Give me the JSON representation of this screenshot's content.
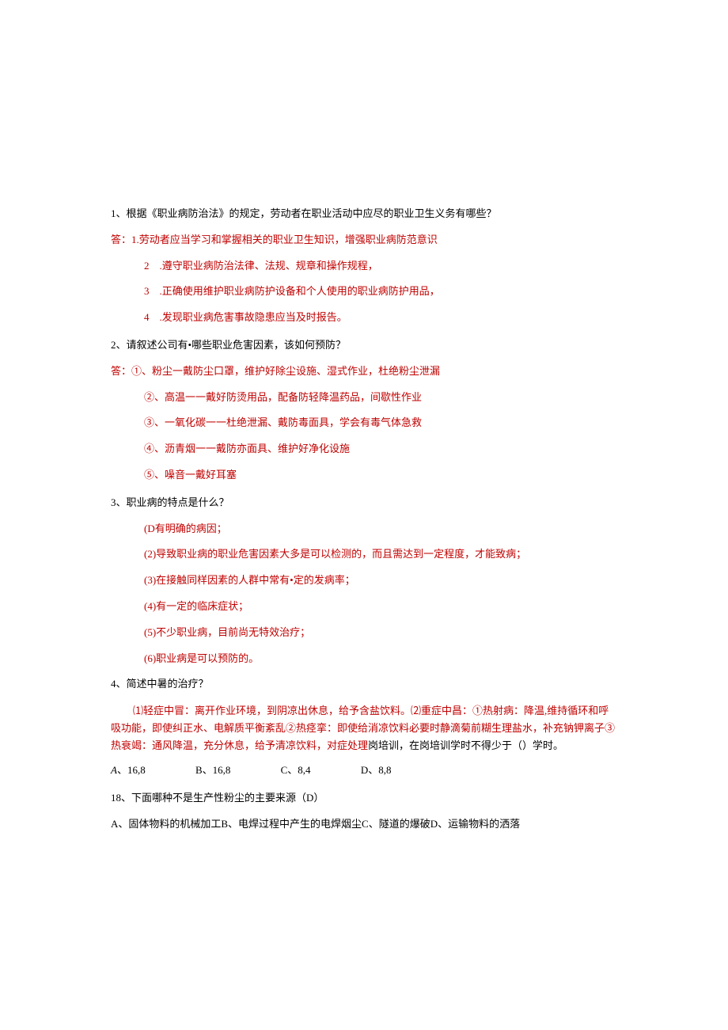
{
  "q1": {
    "text": "1、根据《职业病防治法》的规定，劳动者在职业活动中应尽的职业卫生义务有哪些？",
    "ans_prefix": "答：1.劳动者应当学习和掌握相关的职业卫生知识，增强职业病防范意识",
    "a2": "2　.遵守职业病防治法律、法规、规章和操作规程，",
    "a3": "3　.正确使用维护职业病防护设备和个人使用的职业病防护用品，",
    "a4": "4　.发现职业病危害事故隐患应当及时报告。"
  },
  "q2": {
    "text": "2、请叙述公司有•哪些职业危害因素，该如何预防？",
    "ans_prefix": "答：①、粉尘一戴防尘口罩，维护好除尘设施、湿式作业，杜绝粉尘泄漏",
    "a2": "②、高温一一戴好防烫用品，配备防轻降温药品，间歇性作业",
    "a3": "③、一氧化碳一一杜绝泄漏、戴防毒面具，学会有毒气体急救",
    "a4": "④、沥青烟一一戴防亦面具、维护好净化设施",
    "a5": "⑤、噪音一戴好耳塞"
  },
  "q3": {
    "text": "3、职业病的特点是什么？",
    "a1": "(D有明确的病因；",
    "a2": "(2)导致职业病的职业危害因素大多是可以检测的，而且需达到一定程度，才能致病；",
    "a3": "(3)在接触同样因素的人群中常有•定的发病率；",
    "a4": "(4)有一定的临床症状；",
    "a5": "(5)不少职业病，目前尚无特效治疗；",
    "a6": "(6)职业病是可以预防的。"
  },
  "q4": {
    "text": "4、简述中暑的治疗？",
    "red_part": "⑴轻症中冒：离开作业环境，到阴凉出休息，给予含盐饮料。⑵重症中昌：①热射病：降温,维持循环和呼吸功能，即使纠正水、电解质平衡紊乱②热痉挛：即使给消凉饮料必要时静滴菊前糊生理盐水，补充钠钾离子③热衰竭：通风降温，充分休息，给予清凉饮料，对症处理",
    "black_part": "岗培训，在岗培训学时不得少于（）学时。"
  },
  "opts": {
    "a": "A、16,8",
    "b": "B、16,8",
    "c": "C、8,4",
    "d": "D、8,8"
  },
  "q18": {
    "text": "18、下面哪种不是生产性粉尘的主要来源（D）",
    "line": "A、固体物料的机械加工B、电焊过程中产生的电焊烟尘C、隧道的爆破D、运输物料的洒落"
  }
}
